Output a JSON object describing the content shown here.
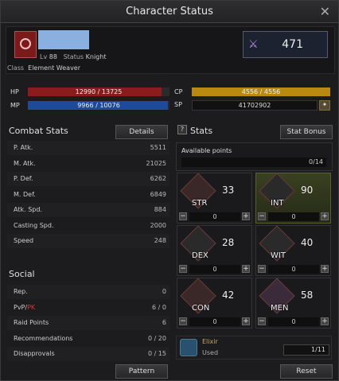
{
  "window": {
    "title": "Character Status"
  },
  "character": {
    "level_label": "Lv",
    "level": "88",
    "status_label": "Status",
    "status": "Knight",
    "class_label": "Class",
    "class": "Element Weaver",
    "power": "471"
  },
  "bars": {
    "hp_label": "HP",
    "hp": "12990 / 13725",
    "hp_frac": 0.946,
    "mp_label": "MP",
    "mp": "9966 / 10076",
    "mp_frac": 0.989,
    "cp_label": "CP",
    "cp": "4556 / 4556",
    "cp_frac": 1,
    "sp_label": "SP",
    "sp": "41702902"
  },
  "combat": {
    "title": "Combat Stats",
    "details_label": "Details",
    "rows": [
      {
        "k": "P. Atk.",
        "v": "5511"
      },
      {
        "k": "M. Atk.",
        "v": "21025"
      },
      {
        "k": "P. Def.",
        "v": "6262"
      },
      {
        "k": "M. Def.",
        "v": "6849"
      },
      {
        "k": "Atk. Spd.",
        "v": "884"
      },
      {
        "k": "Casting Spd.",
        "v": "2000"
      },
      {
        "k": "Speed",
        "v": "248"
      }
    ]
  },
  "social": {
    "title": "Social",
    "rows": [
      {
        "k": "Rep.",
        "v": "0"
      },
      {
        "k": "PvP/",
        "k2": "PK",
        "v": "6 / 0"
      },
      {
        "k": "Raid Points",
        "v": "6"
      },
      {
        "k": "Recommendations",
        "v": "0 / 20"
      },
      {
        "k": "Disapprovals",
        "v": "0 / 15"
      }
    ],
    "pattern_label": "Pattern"
  },
  "stats": {
    "title": "Stats",
    "bonus_label": "Stat Bonus",
    "available_label": "Available points",
    "available": "0/14",
    "cells": [
      {
        "name": "STR",
        "value": "33",
        "add": "0"
      },
      {
        "name": "INT",
        "value": "90",
        "add": "0"
      },
      {
        "name": "DEX",
        "value": "28",
        "add": "0"
      },
      {
        "name": "WIT",
        "value": "40",
        "add": "0"
      },
      {
        "name": "CON",
        "value": "42",
        "add": "0"
      },
      {
        "name": "MEN",
        "value": "58",
        "add": "0"
      }
    ],
    "minus": "−",
    "plus": "+",
    "elixir_name": "Elixir",
    "elixir_status": "Used",
    "elixir_count": "1/11",
    "reset_label": "Reset"
  },
  "colors": {
    "hp": "#8a1c1c",
    "mp": "#1d4a9a",
    "cp": "#b88a10"
  }
}
